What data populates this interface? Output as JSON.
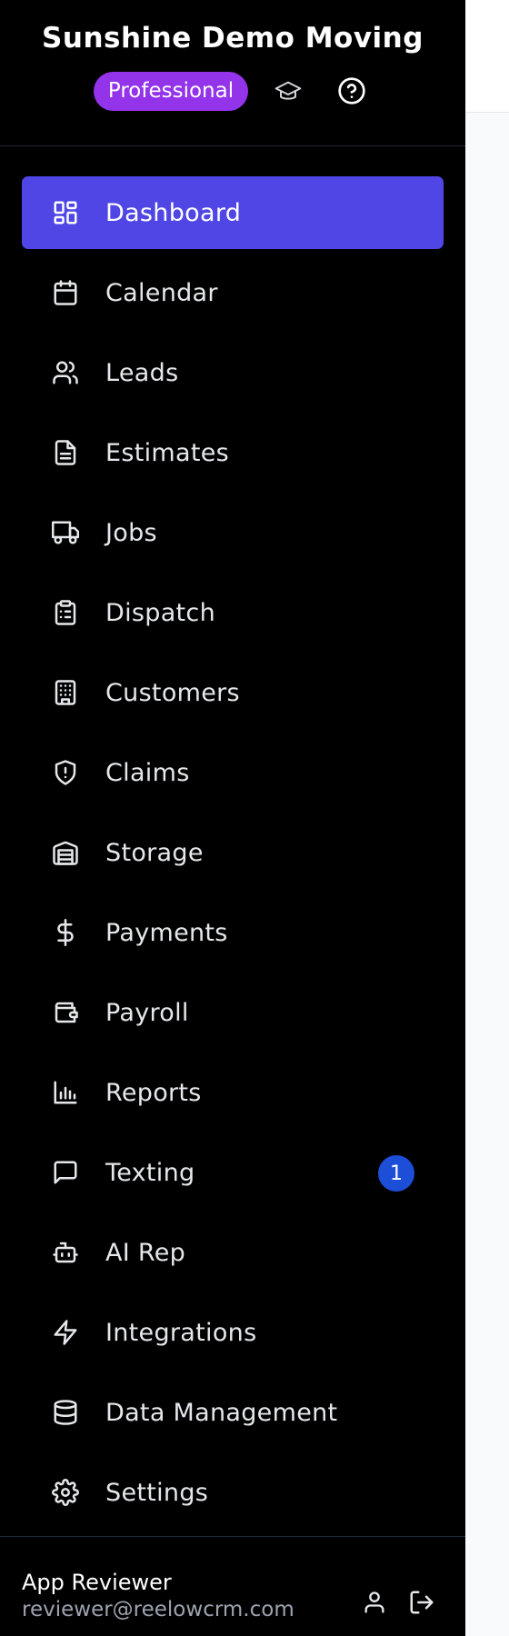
{
  "brand": {
    "title": "Sunshine Demo Moving",
    "plan_badge": "Professional",
    "academy_icon": "graduation-cap-icon",
    "help_icon": "help-circle-icon"
  },
  "nav": {
    "items": [
      {
        "label": "Dashboard",
        "icon": "dashboard-icon",
        "active": true
      },
      {
        "label": "Calendar",
        "icon": "calendar-icon"
      },
      {
        "label": "Leads",
        "icon": "users-icon"
      },
      {
        "label": "Estimates",
        "icon": "document-icon"
      },
      {
        "label": "Jobs",
        "icon": "truck-icon"
      },
      {
        "label": "Dispatch",
        "icon": "clipboard-list-icon"
      },
      {
        "label": "Customers",
        "icon": "building-icon"
      },
      {
        "label": "Claims",
        "icon": "shield-alert-icon"
      },
      {
        "label": "Storage",
        "icon": "warehouse-icon"
      },
      {
        "label": "Payments",
        "icon": "dollar-icon"
      },
      {
        "label": "Payroll",
        "icon": "wallet-icon"
      },
      {
        "label": "Reports",
        "icon": "bar-chart-icon"
      },
      {
        "label": "Texting",
        "icon": "message-square-icon",
        "badge": "1"
      },
      {
        "label": "AI Rep",
        "icon": "bot-icon"
      },
      {
        "label": "Integrations",
        "icon": "zap-icon"
      },
      {
        "label": "Data Management",
        "icon": "database-icon"
      },
      {
        "label": "Settings",
        "icon": "gear-icon"
      }
    ]
  },
  "footer": {
    "user_name": "App Reviewer",
    "user_email": "reviewer@reelowcrm.com",
    "profile_icon": "user-icon",
    "logout_icon": "logout-icon"
  },
  "colors": {
    "sidebar_bg": "#000000",
    "active_item": "#4f46e5",
    "plan_badge": "#9333ea",
    "notification_badge": "#1d4ed8"
  }
}
